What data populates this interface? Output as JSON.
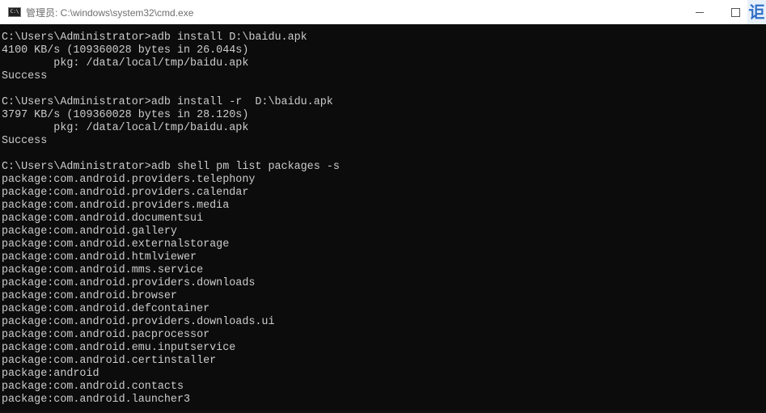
{
  "window": {
    "title": "管理员: C:\\windows\\system32\\cmd.exe",
    "icon_label": "C:\\",
    "overlay_glyph": "讵"
  },
  "console": {
    "lines": [
      "",
      "C:\\Users\\Administrator>adb install D:\\baidu.apk",
      "4100 KB/s (109360028 bytes in 26.044s)",
      "        pkg: /data/local/tmp/baidu.apk",
      "Success",
      "",
      "C:\\Users\\Administrator>adb install -r  D:\\baidu.apk",
      "3797 KB/s (109360028 bytes in 28.120s)",
      "        pkg: /data/local/tmp/baidu.apk",
      "Success",
      "",
      "C:\\Users\\Administrator>adb shell pm list packages -s",
      "package:com.android.providers.telephony",
      "package:com.android.providers.calendar",
      "package:com.android.providers.media",
      "package:com.android.documentsui",
      "package:com.android.gallery",
      "package:com.android.externalstorage",
      "package:com.android.htmlviewer",
      "package:com.android.mms.service",
      "package:com.android.providers.downloads",
      "package:com.android.browser",
      "package:com.android.defcontainer",
      "package:com.android.providers.downloads.ui",
      "package:com.android.pacprocessor",
      "package:com.android.emu.inputservice",
      "package:com.android.certinstaller",
      "package:android",
      "package:com.android.contacts",
      "package:com.android.launcher3"
    ]
  },
  "colors": {
    "background": "#0c0c0c",
    "text": "#cccccc",
    "titlebar": "#ffffff"
  },
  "icons": {
    "app": "cmd-icon",
    "minimize": "minimize-icon",
    "maximize": "maximize-icon"
  }
}
